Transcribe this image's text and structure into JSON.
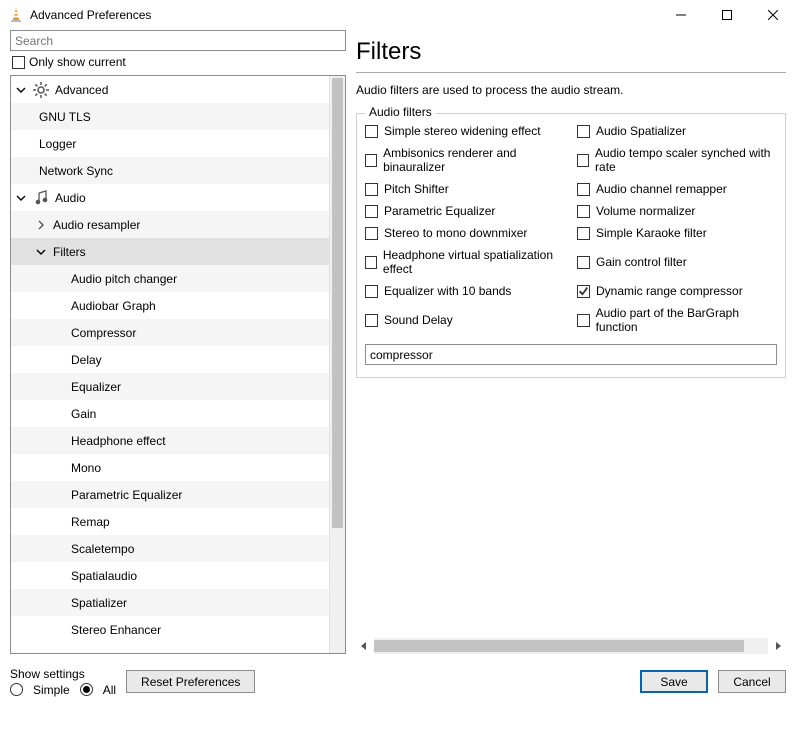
{
  "window": {
    "title": "Advanced Preferences"
  },
  "search": {
    "placeholder": "Search"
  },
  "only_show_current": {
    "label": "Only show current",
    "checked": false
  },
  "tree": {
    "nodes": [
      {
        "label": "Advanced",
        "icon": "gear",
        "depth": 0,
        "expand": "open"
      },
      {
        "label": "GNU TLS",
        "depth": 1
      },
      {
        "label": "Logger",
        "depth": 1
      },
      {
        "label": "Network Sync",
        "depth": 1
      },
      {
        "label": "Audio",
        "icon": "music",
        "depth": 0,
        "expand": "open"
      },
      {
        "label": "Audio resampler",
        "depth": 1,
        "expand": "closed",
        "toggle": true
      },
      {
        "label": "Filters",
        "depth": 1,
        "expand": "open",
        "toggle": true,
        "selected": true
      },
      {
        "label": "Audio pitch changer",
        "depth": 2
      },
      {
        "label": "Audiobar Graph",
        "depth": 2
      },
      {
        "label": "Compressor",
        "depth": 2
      },
      {
        "label": "Delay",
        "depth": 2
      },
      {
        "label": "Equalizer",
        "depth": 2
      },
      {
        "label": "Gain",
        "depth": 2
      },
      {
        "label": "Headphone effect",
        "depth": 2
      },
      {
        "label": "Mono",
        "depth": 2
      },
      {
        "label": "Parametric Equalizer",
        "depth": 2
      },
      {
        "label": "Remap",
        "depth": 2
      },
      {
        "label": "Scaletempo",
        "depth": 2
      },
      {
        "label": "Spatialaudio",
        "depth": 2
      },
      {
        "label": "Spatializer",
        "depth": 2
      },
      {
        "label": "Stereo Enhancer",
        "depth": 2
      }
    ]
  },
  "panel": {
    "title": "Filters",
    "description": "Audio filters are used to process the audio stream.",
    "group_title": "Audio filters",
    "options_left": [
      {
        "label": "Simple stereo widening effect",
        "checked": false
      },
      {
        "label": "Ambisonics renderer and binauralizer",
        "checked": false
      },
      {
        "label": "Pitch Shifter",
        "checked": false
      },
      {
        "label": "Parametric Equalizer",
        "checked": false
      },
      {
        "label": "Stereo to mono downmixer",
        "checked": false
      },
      {
        "label": "Headphone virtual spatialization effect",
        "checked": false
      },
      {
        "label": "Equalizer with 10 bands",
        "checked": false
      },
      {
        "label": "Sound Delay",
        "checked": false
      }
    ],
    "options_right": [
      {
        "label": "Audio Spatializer",
        "checked": false
      },
      {
        "label": "Audio tempo scaler synched with rate",
        "checked": false
      },
      {
        "label": "Audio channel remapper",
        "checked": false
      },
      {
        "label": "Volume normalizer",
        "checked": false
      },
      {
        "label": "Simple Karaoke filter",
        "checked": false
      },
      {
        "label": "Gain control filter",
        "checked": false
      },
      {
        "label": "Dynamic range compressor",
        "checked": true
      },
      {
        "label": "Audio part of the BarGraph function",
        "checked": false
      }
    ],
    "filter_value": "compressor"
  },
  "footer": {
    "show_settings_label": "Show settings",
    "simple_label": "Simple",
    "all_label": "All",
    "selected": "all",
    "reset_label": "Reset Preferences",
    "save_label": "Save",
    "cancel_label": "Cancel"
  }
}
